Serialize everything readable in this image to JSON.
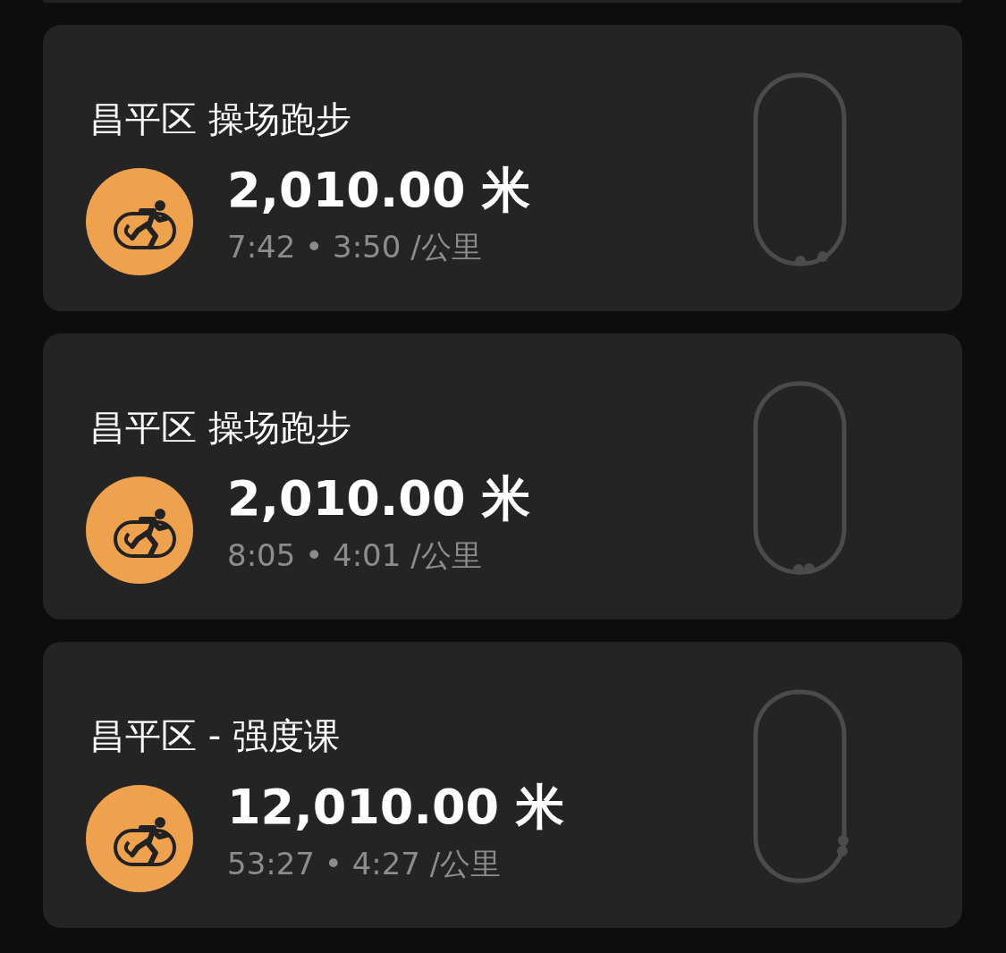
{
  "activities": [
    {
      "title": "昌平区 操场跑步",
      "distance": "2,010.00 米",
      "detail": "7:42 • 3:50 /公里"
    },
    {
      "title": "昌平区 操场跑步",
      "distance": "2,010.00 米",
      "detail": "8:05 • 4:01 /公里"
    },
    {
      "title": "昌平区 - 强度课",
      "distance": "12,010.00 米",
      "detail": "53:27 • 4:27 /公里"
    }
  ]
}
